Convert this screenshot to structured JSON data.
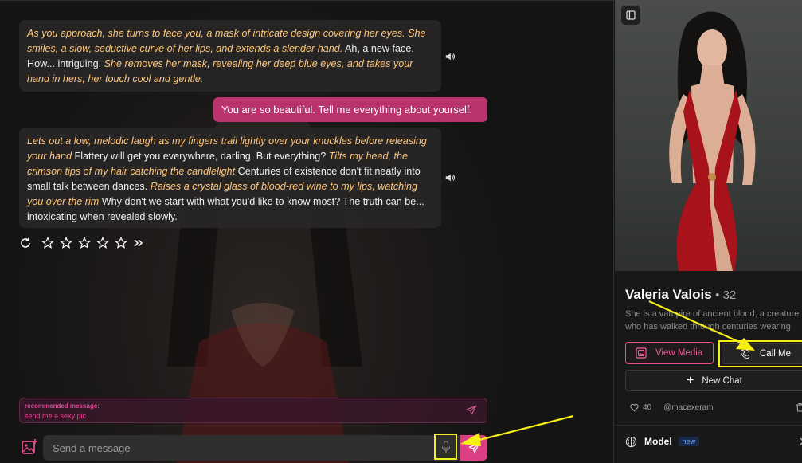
{
  "messages": [
    {
      "role": "character",
      "parts": [
        {
          "text": "As you approach, she turns to face you, a mask of intricate design covering her eyes. She smiles, a slow, seductive curve of her lips, and extends a slender hand.",
          "italic": true
        },
        {
          "text": " Ah, a new face. How... intriguing. ",
          "italic": false
        },
        {
          "text": "She removes her mask, revealing her deep blue eyes, and takes your hand in hers, her touch cool and gentle.",
          "italic": true
        }
      ]
    },
    {
      "role": "user",
      "text": "You are so beautiful. Tell me everything about yourself."
    },
    {
      "role": "character",
      "parts": [
        {
          "text": "Lets out a low, melodic laugh as my fingers trail lightly over your knuckles before releasing your hand",
          "italic": true
        },
        {
          "text": " Flattery will get you everywhere, darling. But everything? ",
          "italic": false
        },
        {
          "text": "Tilts my head, the crimson tips of my hair catching the candlelight",
          "italic": true
        },
        {
          "text": " Centuries of existence don't fit neatly into small talk between dances. ",
          "italic": false
        },
        {
          "text": "Raises a crystal glass of blood-red wine to my lips, watching you over the rim",
          "italic": true
        },
        {
          "text": " Why don't we start with what you'd like to know most? The truth can be... intoxicating when revealed slowly.",
          "italic": false
        }
      ]
    }
  ],
  "rating": {
    "stars": 5,
    "filled": 0
  },
  "icons": {
    "speaker": "speaker-icon",
    "regenerate": "refresh-icon",
    "star": "star-icon",
    "more": "double-chevron-right-icon",
    "image": "image-upload-icon",
    "mic": "microphone-icon",
    "send": "send-icon",
    "panel": "panel-toggle-icon",
    "media": "gallery-icon",
    "phone": "phone-icon",
    "heart": "heart-icon",
    "trash": "trash-icon",
    "brain": "brain-icon",
    "chevron": "chevron-right-icon"
  },
  "recommended": {
    "label": "recommended message:",
    "text": "send me a sexy pic"
  },
  "composer": {
    "placeholder": "Send a message"
  },
  "profile": {
    "name": "Valeria Valois",
    "age_text": "• 32",
    "description_line1": "She is a vampire of ancient blood, a creature",
    "description_line2": "who has walked through centuries wearing",
    "view_media": "View Media",
    "call_me": "Call Me",
    "new_chat": "New Chat",
    "likes": "40",
    "creator": "@macexeram",
    "model_label": "Model",
    "model_badge": "new"
  },
  "colors": {
    "accent": "#dc3f83",
    "user_bubble": "#b9346f",
    "narration": "#ffc77a",
    "highlight": "#f6ee14",
    "badge_blue": "#76a9ff"
  }
}
